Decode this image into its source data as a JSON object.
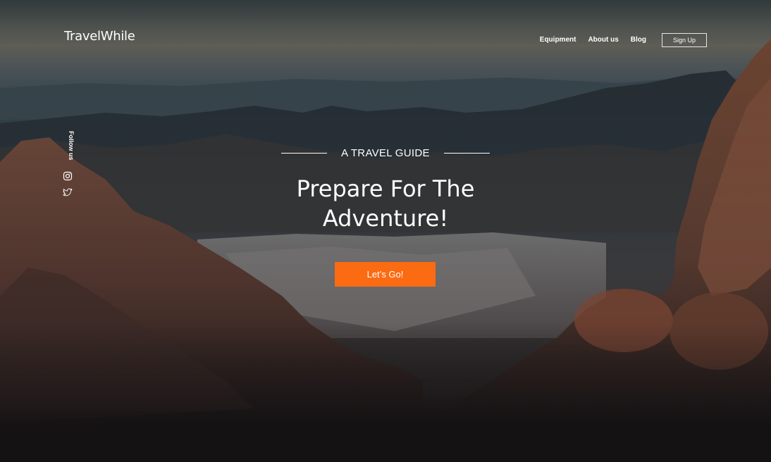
{
  "brand": {
    "logo": "TravelWhile"
  },
  "nav": {
    "items": [
      "Equipment",
      "About us",
      "Blog"
    ],
    "signup_label": "Sign Up"
  },
  "social": {
    "label": "Follow us",
    "icons": [
      "instagram-icon",
      "twitter-icon"
    ]
  },
  "hero": {
    "kicker": "A TRAVEL GUIDE",
    "headline": "Prepare For  The\nAdventure!",
    "cta_label": "Let’s Go!"
  },
  "colors": {
    "accent": "#fb6b12",
    "background": "#141213",
    "text": "#ffffff"
  }
}
